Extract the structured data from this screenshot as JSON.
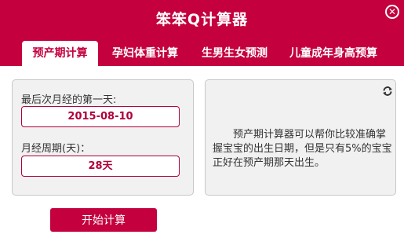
{
  "header": {
    "title": "笨笨Q计算器",
    "close_icon": "close-icon"
  },
  "tabs": [
    {
      "label": "预产期计算",
      "active": true
    },
    {
      "label": "孕妇体重计算",
      "active": false
    },
    {
      "label": "生男生女预测",
      "active": false
    },
    {
      "label": "儿童成年身高预算",
      "active": false
    }
  ],
  "form": {
    "last_period_label": "最后次月经的第一天:",
    "last_period_value": "2015-08-10",
    "cycle_label": "月经周期(天)：",
    "cycle_value": "28天"
  },
  "info": {
    "text": "预产期计算器可以帮你比较准确掌握宝宝的出生日期，但是只有5%的宝宝正好在预产期那天出生。",
    "refresh_icon": "refresh-icon"
  },
  "actions": {
    "start_label": "开始计算"
  },
  "colors": {
    "brand": "#c4003e",
    "panel_bg": "#f1f1f1",
    "border": "#c7c7c7"
  }
}
